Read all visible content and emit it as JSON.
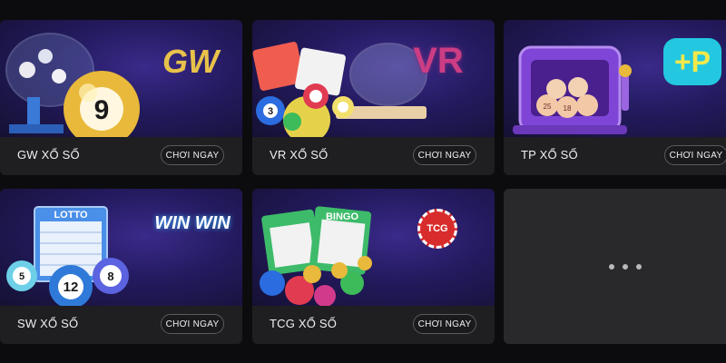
{
  "cards": [
    {
      "title": "GW XỔ SỐ",
      "cta": "CHƠI NGAY",
      "logo_text": "GW",
      "icon": "lottery-machine-gold-ball"
    },
    {
      "title": "VR XỔ SỐ",
      "cta": "CHƠI NGAY",
      "logo_text": "VR",
      "icon": "bingo-balls-cage"
    },
    {
      "title": "TP XỔ SỐ",
      "cta": "CHƠI NGAY",
      "logo_text": "+P",
      "icon": "slot-machine-balls"
    },
    {
      "title": "SW XỔ SỐ",
      "cta": "CHƠI NGAY",
      "logo_text": "WIN WIN",
      "icon": "lotto-ticket-balls",
      "ticket_label": "LOTTO"
    },
    {
      "title": "TCG XỔ SỐ",
      "cta": "CHƠI NGAY",
      "logo_text": "TCG",
      "icon": "bingo-tickets-coins",
      "ticket_label": "BINGO"
    }
  ],
  "more": {
    "icon": "more-dots-icon"
  },
  "colors": {
    "background": "#0c0c0f",
    "card": "#1f1f22",
    "banner": "#231a5e",
    "accent_gold": "#e8c24a"
  }
}
